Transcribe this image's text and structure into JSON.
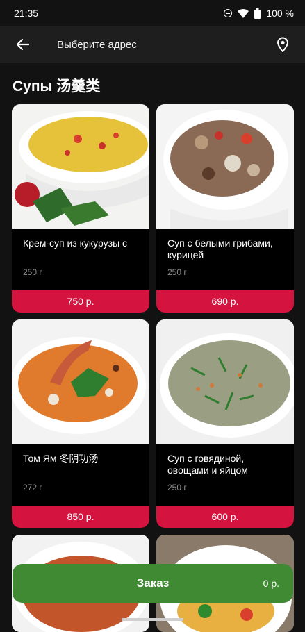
{
  "status": {
    "time": "21:35",
    "battery": "100 %"
  },
  "header": {
    "title": "Выберите адрес"
  },
  "section": {
    "title": "Супы 汤羹类"
  },
  "items": [
    {
      "name": "Крем-суп из кукурузы с",
      "weight": "250 г",
      "price": "750 р."
    },
    {
      "name": "Суп с белыми грибами, курицей",
      "weight": "250 г",
      "price": "690 р."
    },
    {
      "name": "Том Ям 冬阴功汤",
      "weight": "272 г",
      "price": "850 р."
    },
    {
      "name": "Суп с говядиной, овощами и яйцом",
      "weight": "250 г",
      "price": "600 р."
    }
  ],
  "order": {
    "label": "Заказ",
    "total": "0 р."
  },
  "colors": {
    "accent": "#d4143f",
    "order": "#3f8a33",
    "background": "#121212"
  }
}
